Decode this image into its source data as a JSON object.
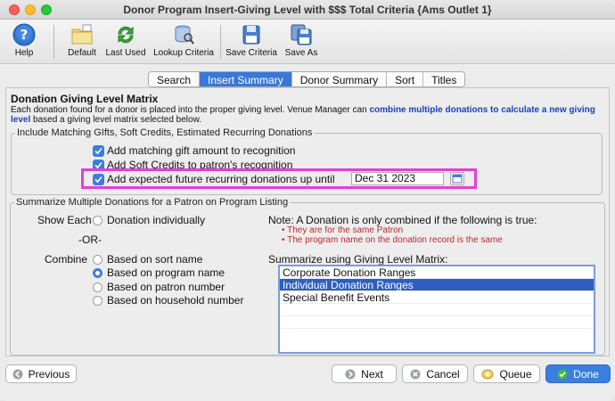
{
  "window": {
    "title": "Donor Program Insert-Giving Level with $$$ Total Criteria {Ams Outlet 1}"
  },
  "toolbar": {
    "help": "Help",
    "default": "Default",
    "last_used": "Last Used",
    "lookup_criteria": "Lookup Criteria",
    "save_criteria": "Save Criteria",
    "save_as": "Save As"
  },
  "tabs": [
    {
      "label": "Search"
    },
    {
      "label": "Insert Summary"
    },
    {
      "label": "Donor Summary"
    },
    {
      "label": "Sort"
    },
    {
      "label": "Titles"
    }
  ],
  "section": {
    "title": "Donation Giving Level Matrix",
    "desc_1": "Each donation found for a donor is placed into the proper giving level.   Venue Manager can ",
    "desc_link": "combine multiple donations to calculate a new giving level",
    "desc_2": " based a giving level matrix selected below."
  },
  "matching": {
    "legend": "Include Matching GIfts, Soft Credits, Estimated Recurring Donations",
    "opt1": "Add matching gift amount to recognition",
    "opt2": "Add Soft Credits to patron's recognition",
    "opt3": "Add expected future recurring donations up until",
    "date": "Dec 31 2023"
  },
  "summarize": {
    "legend": "Summarize Multiple Donations for a Patron on Program Listing",
    "show_each": "Show Each",
    "donation_individually": "Donation individually",
    "or": "-OR-",
    "combine": "Combine",
    "combine_options": [
      "Based on sort name",
      "Based on program name",
      "Based on patron number",
      "Based on household number"
    ],
    "note": "Note: A Donation is only combined if the following is true:",
    "note_items": [
      "They are for the same Patron",
      "The program name on the donation record is the same"
    ],
    "matrix_label": "Summarize using Giving Level Matrix:",
    "matrix_items": [
      "Corporate Donation Ranges",
      "Individual Donation Ranges",
      "Special Benefit Events"
    ]
  },
  "buttons": {
    "previous": "Previous",
    "next": "Next",
    "cancel": "Cancel",
    "queue": "Queue",
    "done": "Done"
  },
  "colors": {
    "accent": "#3a7ee0",
    "highlight": "#e23fd8",
    "link": "#1a3fb8",
    "note_red": "#c0282c"
  }
}
